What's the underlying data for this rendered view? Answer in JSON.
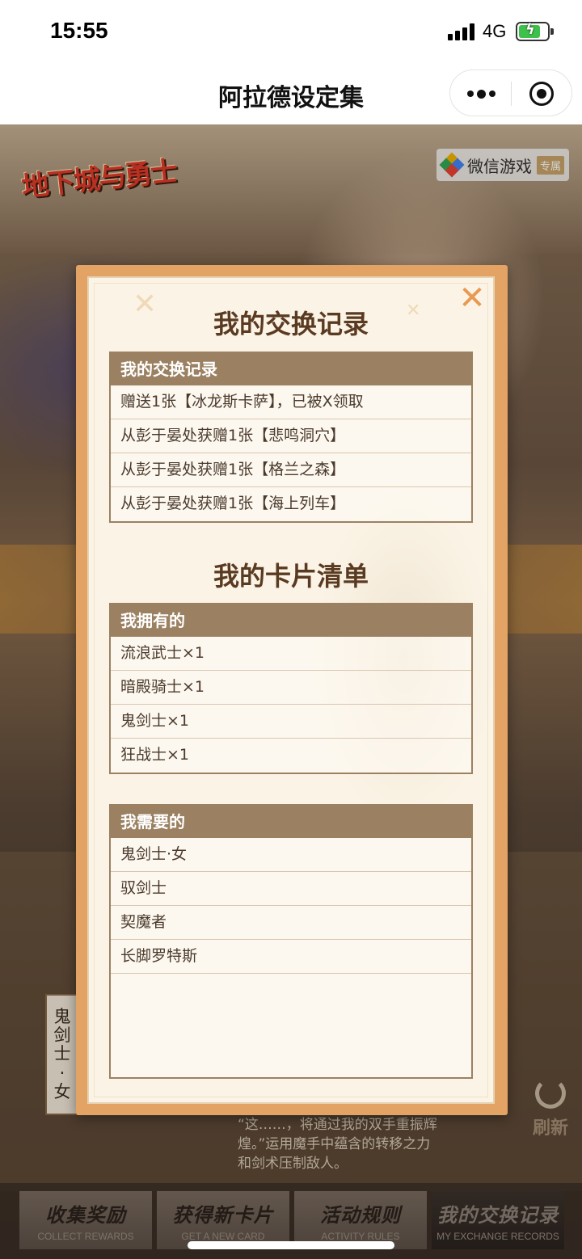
{
  "status_bar": {
    "time": "15:55",
    "network": "4G"
  },
  "nav": {
    "title": "阿拉德设定集"
  },
  "background": {
    "game_logo": "地下城与勇士",
    "wechat_tag": "微信游戏",
    "wechat_badge": "专属",
    "side_card_chars": [
      "鬼",
      "剑",
      "士",
      "·",
      "女"
    ],
    "refresh_label": "刷新",
    "quote": "“这……，将通过我的双手重振辉煌。”运用魔手中蕴含的转移之力和剑术压制敌人。"
  },
  "modal": {
    "exchange_title": "我的交换记录",
    "exchange_table": {
      "header": "我的交换记录",
      "rows": [
        "赠送1张【冰龙斯卡萨】，已被X领取",
        "从彭于晏处获赠1张【悲鸣洞穴】",
        "从彭于晏处获赠1张【格兰之森】",
        "从彭于晏处获赠1张【海上列车】"
      ]
    },
    "cards_title": "我的卡片清单",
    "owned_table": {
      "header": "我拥有的",
      "rows": [
        "流浪武士×1",
        "暗殿骑士×1",
        "鬼剑士×1",
        "狂战士×1"
      ]
    },
    "needed_table": {
      "header": "我需要的",
      "rows": [
        "鬼剑士·女",
        "驭剑士",
        "契魔者",
        "长脚罗特斯"
      ]
    }
  },
  "tabs": [
    {
      "label": "收集奖励",
      "en": "COLLECT REWARDS"
    },
    {
      "label": "获得新卡片",
      "en": "GET A NEW CARD"
    },
    {
      "label": "活动规则",
      "en": "ACTIVITY RULES"
    },
    {
      "label": "我的交换记录",
      "en": "MY EXCHANGE RECORDS"
    }
  ],
  "colors": {
    "modal_frame": "#e3a365",
    "modal_bg": "#fbf4e6",
    "table_header": "#9b8162",
    "title_brown": "#5a3b22",
    "close_orange": "#e89a52"
  },
  "icons": {
    "close": "close-icon",
    "more": "more-dots-icon",
    "capsule_target": "target-circle-icon",
    "refresh": "refresh-icon"
  }
}
